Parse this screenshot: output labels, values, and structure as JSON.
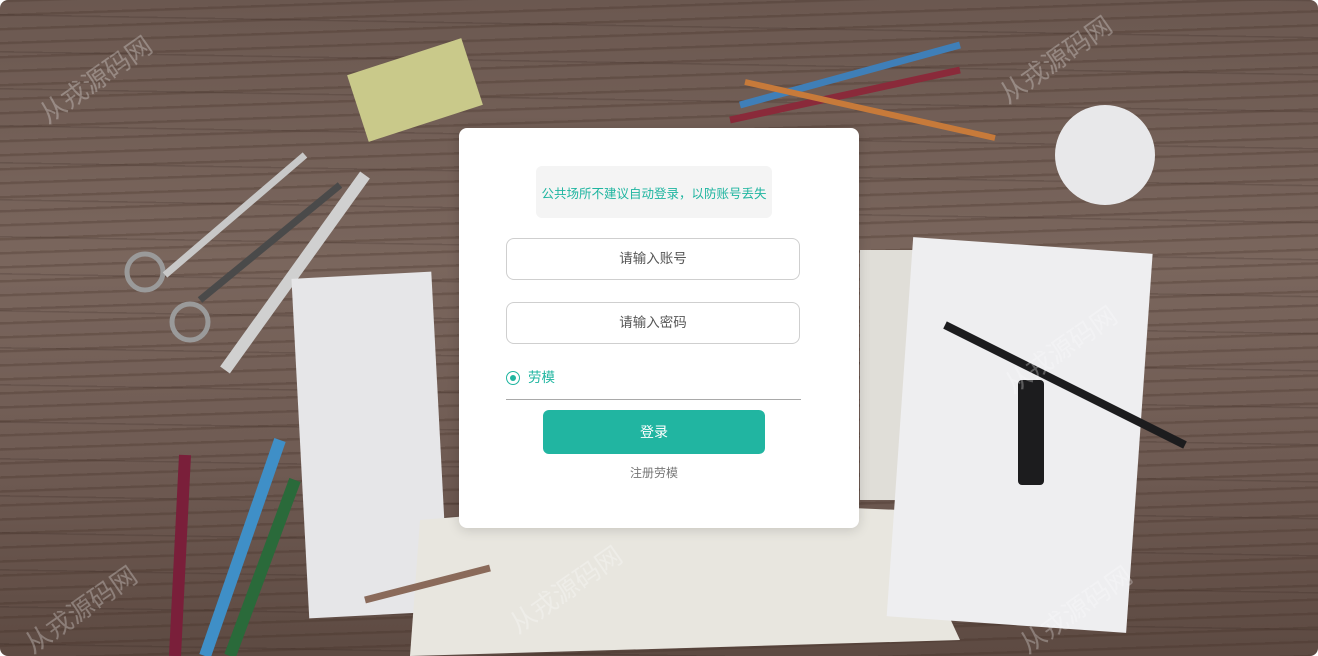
{
  "tip": {
    "text": "公共场所不建议自动登录，以防账号丢失"
  },
  "form": {
    "account_placeholder": "请输入账号",
    "password_placeholder": "请输入密码",
    "role_option": "劳模",
    "login_label": "登录",
    "register_label": "注册劳模"
  },
  "watermark": {
    "text": "从戎源码网"
  },
  "colors": {
    "accent": "#21b5a1",
    "card_bg": "#ffffff",
    "tip_bg": "#f4f4f4"
  }
}
